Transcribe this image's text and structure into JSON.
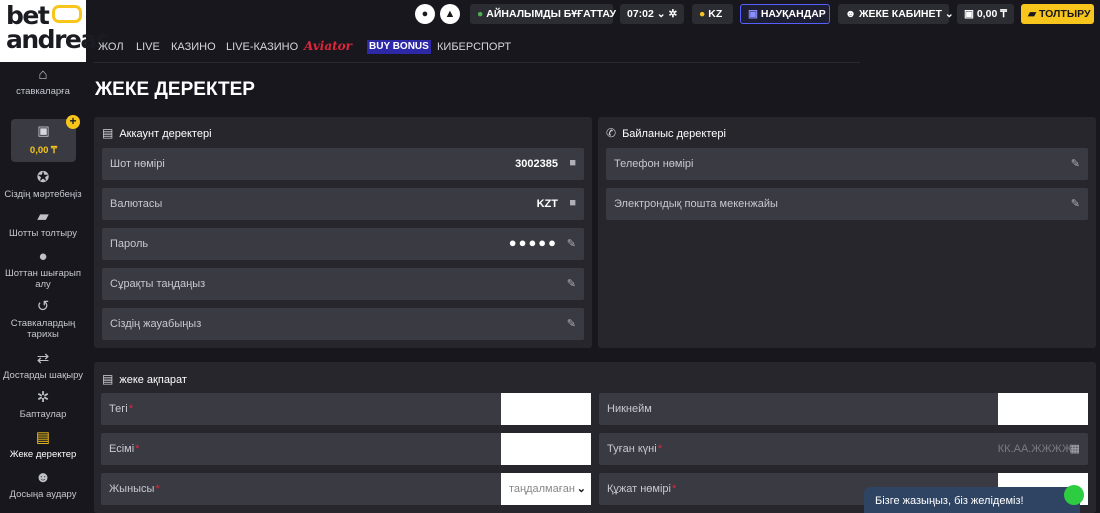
{
  "logo": {
    "line1": "bet",
    "line2": "andreas"
  },
  "topbar": {
    "mirror": "АЙНАЛЫМДЫ БҰҒАТТАУ",
    "time": "07:02",
    "lang": "KZ",
    "promo": "НАУҚАНДАР",
    "cabinet": "ЖЕКЕ КАБИНЕТ",
    "balance": "0,00 ₸",
    "topup": "ТОЛТЫРУ"
  },
  "nav": [
    "ЖОЛ",
    "LIVE",
    "КАЗИНО",
    "LIVE-КАЗИНО",
    "Aviator",
    "BUY BONUS",
    "КИБЕРСПОРТ"
  ],
  "sidebar": {
    "bets": "ставкаларға",
    "balance": "0,00 ₸",
    "items": [
      "Сіздің мәртебеңіз",
      "Шотты толтыру",
      "Шоттан шығарып алу",
      "Ставкалардың тарихы",
      "Достарды шақыру",
      "Баптаулар",
      "Жеке деректер",
      "Досыңа аудару"
    ]
  },
  "page_title": "ЖЕКЕ ДЕРЕКТЕР",
  "account": {
    "title": "Аккаунт деректері",
    "account_number_label": "Шот нөмірі",
    "account_number": "3002385",
    "currency_label": "Валютасы",
    "currency": "KZT",
    "password_label": "Пароль",
    "password_mask": "●●●●●",
    "question_label": "Сұрақты таңдаңыз",
    "answer_label": "Сіздің жауабыңыз"
  },
  "contact": {
    "title": "Байланыс деректері",
    "phone_label": "Телефон нөмірі",
    "email_label": "Электрондық пошта мекенжайы"
  },
  "personal": {
    "title": "жеке ақпарат",
    "surname_label": "Тегі",
    "nickname_label": "Никнейм",
    "name_label": "Есімі",
    "birthdate_label": "Туған күні",
    "birthdate_placeholder": "КК.АА.ЖЖЖЖ",
    "gender_label": "Жынысы",
    "gender_value": "таңдалмаған",
    "document_label": "Құжат нөмірі",
    "required_mark": "*"
  },
  "chat": "Бізге жазыңыз, біз желідеміз!"
}
